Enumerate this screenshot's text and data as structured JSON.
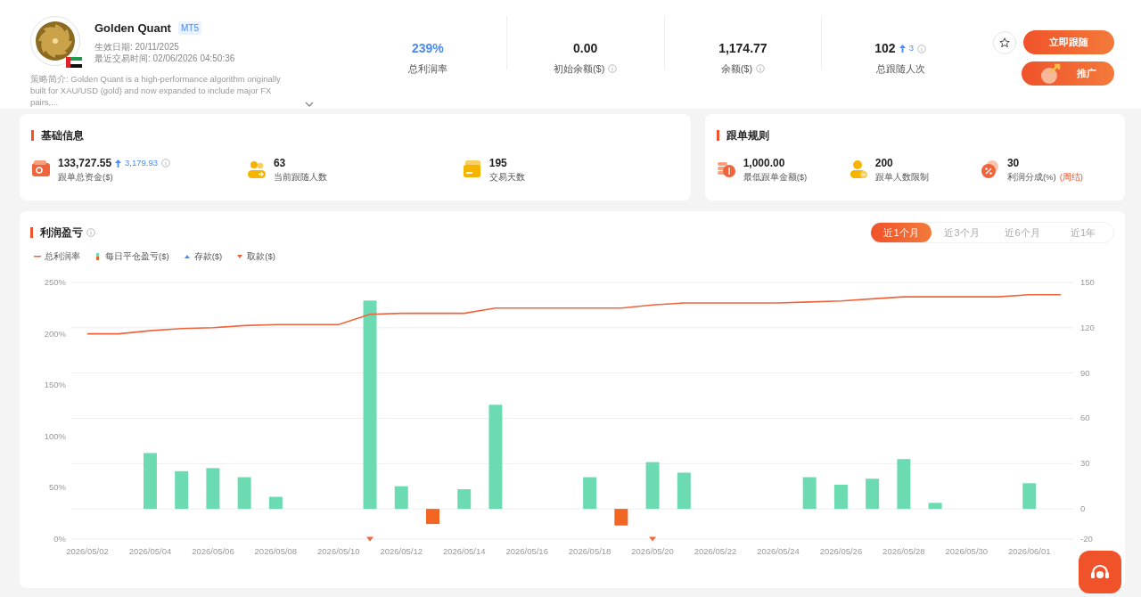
{
  "profile": {
    "name": "Golden Quant",
    "platform": "MT5",
    "effective_date": "生效日期: 20/11/2025",
    "last_trade": "最近交易时间: 02/06/2026 04:50:36",
    "description": "策略简介: Golden Quant is a high-performance algorithm originally built for XAU/USD (gold) and now expanded to include major FX pairs,...",
    "expanded": false
  },
  "stats": [
    {
      "value": "239%",
      "label": "总利润率",
      "highlight": true,
      "info": false
    },
    {
      "value": "0.00",
      "label": "初始余额($)",
      "highlight": false,
      "info": true
    },
    {
      "value": "1,174.77",
      "label": "余额($)",
      "highlight": false,
      "info": true
    },
    {
      "value": "102",
      "change": "3",
      "label": "总跟随人次",
      "highlight": false,
      "info": true
    }
  ],
  "actions": {
    "favorite": false,
    "follow": "立即跟随",
    "promote": "推广"
  },
  "panels": [
    {
      "title": "基础信息",
      "items": [
        {
          "value": "133,727.55",
          "change": "3,179.93",
          "info": true,
          "label": "跟单总资金($)"
        },
        {
          "value": "63",
          "label": "当前跟随人数"
        },
        {
          "value": "195",
          "label": "交易天数"
        }
      ]
    },
    {
      "title": "跟单规则",
      "items": [
        {
          "value": "1,000.00",
          "label": "最低跟单金额($)"
        },
        {
          "value": "200",
          "label": "跟单人数限制"
        },
        {
          "value": "30",
          "label": "利润分成(%)",
          "note": "(周结)"
        }
      ]
    }
  ],
  "profit": {
    "title": "利润盈亏",
    "periods": [
      {
        "label": "近1个月",
        "selected": true
      },
      {
        "label": "近3个月",
        "selected": false
      },
      {
        "label": "近6个月",
        "selected": false
      },
      {
        "label": "近1年",
        "selected": false
      }
    ],
    "legend": [
      {
        "label": "存款($)",
        "kind": "up",
        "color": "#4a8af4"
      }
    ],
    "chart_data": {
      "type": "bar",
      "categories": [
        "2026/05/02",
        null,
        "2026/05/04",
        null,
        "2026/05/06",
        null,
        "2026/05/08",
        null,
        "2026/05/10",
        null,
        "2026/05/12",
        null,
        "2026/05/14",
        null,
        "2026/05/16",
        null,
        "2026/05/18",
        null,
        "2026/05/20",
        null,
        "2026/05/22",
        null,
        "2026/05/24",
        null,
        "2026/05/26",
        null,
        "2026/05/28",
        null,
        "2026/05/30",
        null,
        "2026/06/01",
        null
      ],
      "series": [
        {
          "name": "总利润率",
          "type": "line",
          "color": "#f0643c",
          "values": [
            200,
            200,
            203,
            205,
            206,
            208,
            209,
            209,
            209,
            219,
            220,
            220,
            220,
            225,
            225,
            225,
            225,
            225,
            228,
            230,
            230,
            230,
            230,
            231,
            232,
            234,
            236,
            236,
            236,
            236,
            238,
            238
          ]
        },
        {
          "name": "每日平仓盈亏($)",
          "type": "bar",
          "color": "#6ddbb1",
          "axis": "y2",
          "values": [
            null,
            null,
            37,
            25,
            27,
            21,
            8,
            null,
            null,
            138,
            15,
            null,
            13,
            69,
            null,
            null,
            21,
            null,
            31,
            24,
            null,
            null,
            null,
            21,
            16,
            20,
            33,
            4,
            null,
            null,
            17,
            null
          ]
        },
        {
          "type": "bar",
          "color": "#f26522",
          "axis": "y2",
          "values": [
            null,
            null,
            null,
            null,
            null,
            null,
            null,
            null,
            null,
            null,
            null,
            -10,
            null,
            null,
            null,
            null,
            null,
            -11,
            null,
            null,
            null,
            null,
            null,
            null,
            null,
            null,
            null,
            null,
            null,
            null,
            null,
            null
          ]
        },
        {
          "name": "取款($)",
          "type": "scatter",
          "color": "#f0643c",
          "axis": "y2",
          "values": [
            null,
            null,
            null,
            null,
            null,
            null,
            null,
            null,
            null,
            -20,
            null,
            null,
            null,
            null,
            null,
            null,
            null,
            null,
            -20,
            null,
            null,
            null,
            null,
            null,
            null,
            null,
            null,
            null,
            null,
            null,
            null,
            null
          ]
        }
      ],
      "yticks": [
        {
          "value": 0,
          "label": "0%"
        },
        {
          "value": 50,
          "label": "50%"
        },
        {
          "value": 100,
          "label": "100%"
        },
        {
          "value": 150,
          "label": "150%"
        },
        {
          "value": 200,
          "label": "200%"
        },
        {
          "value": 250,
          "label": "250%"
        }
      ],
      "ylim": [
        0,
        250
      ],
      "y2ticks": [
        -20,
        0,
        30,
        60,
        90,
        120,
        150
      ],
      "y2lim": [
        -20,
        150
      ],
      "grid": true
    }
  }
}
